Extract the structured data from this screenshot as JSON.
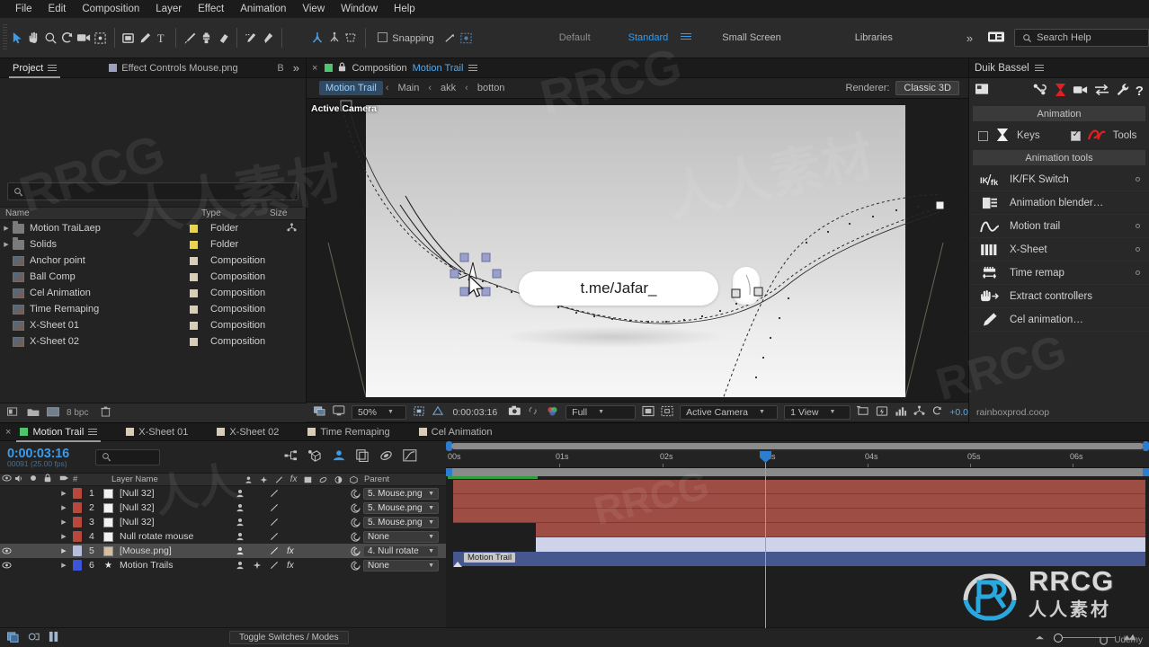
{
  "menubar": {
    "items": [
      "File",
      "Edit",
      "Composition",
      "Layer",
      "Effect",
      "Animation",
      "View",
      "Window",
      "Help"
    ]
  },
  "toolbar": {
    "tools": [
      {
        "name": "selection-tool",
        "label": "Selection"
      },
      {
        "name": "hand-tool",
        "label": "Hand"
      },
      {
        "name": "zoom-tool",
        "label": "Zoom"
      },
      {
        "name": "rotation-tool",
        "label": "Rotation"
      },
      {
        "name": "camera-tool",
        "label": "Unified Camera"
      },
      {
        "name": "pan-behind-tool",
        "label": "Pan Behind"
      },
      {
        "name": "shape-tool",
        "label": "Rectangle"
      },
      {
        "name": "pen-tool",
        "label": "Pen"
      },
      {
        "name": "type-tool",
        "label": "Type"
      },
      {
        "name": "brush-tool",
        "label": "Brush"
      },
      {
        "name": "clone-stamp-tool",
        "label": "Clone Stamp"
      },
      {
        "name": "eraser-tool",
        "label": "Eraser"
      },
      {
        "name": "roto-brush-tool",
        "label": "Roto Brush"
      },
      {
        "name": "puppet-pin-tool",
        "label": "Puppet Pin"
      }
    ],
    "axis_tools": [
      {
        "name": "local-axis-icon"
      },
      {
        "name": "world-axis-icon"
      },
      {
        "name": "view-axis-icon"
      }
    ],
    "snapping_label": "Snapping",
    "snapping_checked": false,
    "workspace_default": "Default",
    "workspace_standard": "Standard",
    "workspace_small_screen": "Small Screen",
    "libraries_label": "Libraries",
    "overflow_label": "»",
    "search_help_placeholder": "Search Help",
    "accent_blue": "#3b9bea"
  },
  "project": {
    "tabs": [
      {
        "label": "Project",
        "active": true
      },
      {
        "label": "Effect Controls Mouse.png",
        "active": false
      }
    ],
    "tab_right_label": "B",
    "overflow": "»",
    "search_placeholder": "",
    "columns": [
      "Name",
      "Type",
      "Size"
    ],
    "items": [
      {
        "name": "Motion TraiLaep",
        "type": "Folder",
        "kind": "folder",
        "twirl": true,
        "badge": "#e8d44d"
      },
      {
        "name": "Solids",
        "type": "Folder",
        "kind": "folder",
        "twirl": true,
        "badge": "#e8d44d"
      },
      {
        "name": "Anchor point",
        "type": "Composition",
        "kind": "comp",
        "twirl": false,
        "badge": "#d8cdb9"
      },
      {
        "name": "Ball Comp",
        "type": "Composition",
        "kind": "comp",
        "twirl": false,
        "badge": "#d8cdb9"
      },
      {
        "name": "Cel Animation",
        "type": "Composition",
        "kind": "comp",
        "twirl": false,
        "badge": "#d8cdb9"
      },
      {
        "name": "Time Remaping",
        "type": "Composition",
        "kind": "comp",
        "twirl": false,
        "badge": "#d8cdb9"
      },
      {
        "name": "X-Sheet 01",
        "type": "Composition",
        "kind": "comp",
        "twirl": false,
        "badge": "#d8cdb9"
      },
      {
        "name": "X-Sheet 02",
        "type": "Composition",
        "kind": "comp",
        "twirl": false,
        "badge": "#d8cdb9"
      }
    ],
    "footer": {
      "bpc": "8 bpc"
    }
  },
  "composition": {
    "tab_label": "Composition",
    "tab_name": "Motion Trail",
    "breadcrumbs": [
      {
        "label": "Motion Trail",
        "active": true
      },
      {
        "label": "Main",
        "active": false
      },
      {
        "label": "akk",
        "active": false
      },
      {
        "label": "botton",
        "active": false
      }
    ],
    "renderer_label": "Renderer:",
    "renderer_value": "Classic 3D",
    "viewport_label": "Active Camera",
    "stage_text": "t.me/Jafar_",
    "bottombar": {
      "zoom": "50%",
      "timecode": "0:00:03:16",
      "resolution": "Full",
      "view_camera": "Active Camera",
      "view_count": "1 View",
      "exposure": "+0.0"
    }
  },
  "duik": {
    "title": "Duik Bassel",
    "sections": {
      "animation": "Animation",
      "animation_tools": "Animation tools"
    },
    "toggles": [
      {
        "label": "Keys",
        "checked": false,
        "icon": "keys-icon"
      },
      {
        "label": "Tools",
        "checked": true,
        "icon": "tools-icon"
      }
    ],
    "tools": [
      {
        "label": "IK/FK Switch",
        "icon": "ik-fk-icon",
        "dot": true
      },
      {
        "label": "Animation blender…",
        "icon": "animation-blender-icon",
        "dot": false
      },
      {
        "label": "Motion trail",
        "icon": "motion-trail-icon",
        "dot": true
      },
      {
        "label": "X-Sheet",
        "icon": "x-sheet-icon",
        "dot": true
      },
      {
        "label": "Time remap",
        "icon": "time-remap-icon",
        "dot": true
      },
      {
        "label": "Extract controllers",
        "icon": "extract-controllers-icon",
        "dot": false
      },
      {
        "label": "Cel animation…",
        "icon": "cel-animation-icon",
        "dot": false
      }
    ],
    "footer": "rainboxprod.coop"
  },
  "timeline": {
    "tabs": [
      {
        "label": "Motion Trail",
        "active": true,
        "color": "#4ec46e"
      },
      {
        "label": "X-Sheet 01",
        "active": false,
        "color": "#d8cdb9"
      },
      {
        "label": "X-Sheet 02",
        "active": false,
        "color": "#d8cdb9"
      },
      {
        "label": "Time Remaping",
        "active": false,
        "color": "#d8cdb9"
      },
      {
        "label": "Cel Animation",
        "active": false,
        "color": "#d8cdb9"
      }
    ],
    "timecode": "0:00:03:16",
    "frame_info": "00091 (25.00 fps)",
    "search_placeholder": "",
    "columns": {
      "num": "#",
      "layer_name": "Layer Name",
      "parent": "Parent"
    },
    "ruler_ticks": [
      "00s",
      "01s",
      "02s",
      "03s",
      "04s",
      "05s",
      "06s"
    ],
    "layers": [
      {
        "index": "1",
        "name": "[Null 32]",
        "parent": "5. Mouse.png",
        "color": "#b8483c",
        "visible": false,
        "selected": false,
        "fx": false,
        "star": false,
        "barcolor": "#9e4d44"
      },
      {
        "index": "2",
        "name": "[Null 32]",
        "parent": "5. Mouse.png",
        "color": "#b8483c",
        "visible": false,
        "selected": false,
        "fx": false,
        "star": false,
        "barcolor": "#9e4d44"
      },
      {
        "index": "3",
        "name": "[Null 32]",
        "parent": "5. Mouse.png",
        "color": "#b8483c",
        "visible": false,
        "selected": false,
        "fx": false,
        "star": false,
        "barcolor": "#9e4d44"
      },
      {
        "index": "4",
        "name": "Null rotate mouse",
        "parent": "None",
        "color": "#b8483c",
        "visible": false,
        "selected": false,
        "fx": false,
        "star": false,
        "barcolor": "#9e4d44"
      },
      {
        "index": "5",
        "name": "[Mouse.png]",
        "parent": "4. Null rotate",
        "color": "#b9bddc",
        "visible": true,
        "selected": true,
        "fx": true,
        "star": false,
        "barcolor": "#cfd3ea"
      },
      {
        "index": "6",
        "name": "Motion Trails",
        "parent": "None",
        "color": "#3b54d8",
        "visible": true,
        "selected": false,
        "fx": true,
        "star": true,
        "barcolor": "#46568f",
        "bar_label": "Motion Trail"
      }
    ],
    "footer": {
      "toggle_switches": "Toggle Switches / Modes"
    }
  },
  "watermarks": {
    "brand": "RRCG",
    "brand_cn": "人人素材",
    "udemy": "Udemy"
  }
}
